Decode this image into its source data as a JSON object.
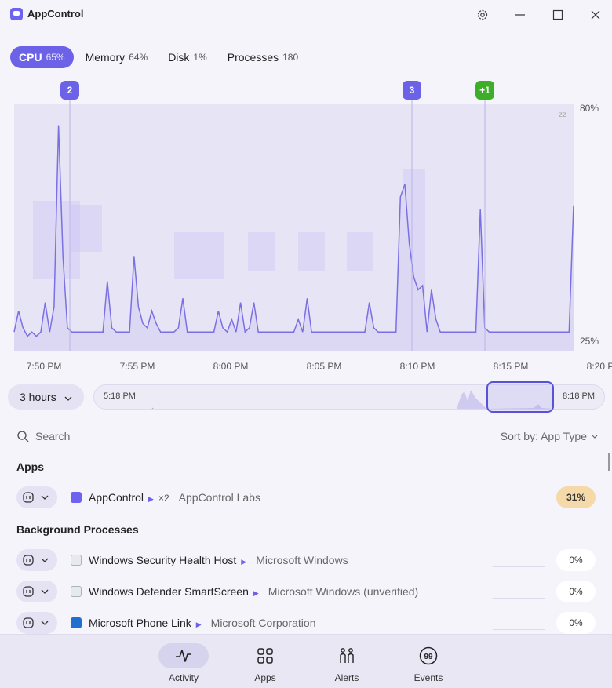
{
  "app": {
    "title": "AppControl"
  },
  "tabs": [
    {
      "label": "CPU",
      "value": "65%",
      "active": true
    },
    {
      "label": "Memory",
      "value": "64%"
    },
    {
      "label": "Disk",
      "value": "1%"
    },
    {
      "label": "Processes",
      "value": "180"
    }
  ],
  "chart": {
    "y_labels": {
      "top": "80%",
      "bottom": "25%"
    },
    "x_labels": [
      "7:50 PM",
      "7:55 PM",
      "8:00 PM",
      "8:05 PM",
      "8:10 PM",
      "8:15 PM",
      "8:20 PM"
    ],
    "markers": [
      {
        "label": "2",
        "color": "#6b62e8"
      },
      {
        "label": "3",
        "color": "#6b62e8"
      },
      {
        "label": "+1",
        "color": "#3cae28"
      }
    ],
    "sleep_icon": "zz"
  },
  "chart_data": {
    "type": "area",
    "ylim": [
      25,
      80
    ],
    "y_ticks": [
      "80%",
      "25%"
    ],
    "x_ticks": [
      "7:50 PM",
      "7:55 PM",
      "8:00 PM",
      "8:05 PM",
      "8:10 PM",
      "8:15 PM",
      "8:20 PM"
    ],
    "series": [
      {
        "values": [
          27,
          32,
          28,
          26,
          27,
          26,
          27,
          34,
          27,
          33,
          76,
          45,
          28,
          27,
          27,
          27,
          27,
          27,
          27,
          27,
          27,
          39,
          28,
          27,
          27,
          27,
          27,
          45,
          33,
          29,
          28,
          32,
          29,
          27,
          27,
          27,
          27,
          28,
          35,
          27,
          27,
          27,
          27,
          27,
          27,
          27,
          32,
          28,
          27,
          30,
          27,
          34,
          27,
          28,
          34,
          27,
          27,
          27,
          27,
          27,
          27,
          27,
          27,
          27,
          30,
          27,
          35,
          27,
          27,
          27,
          27,
          27,
          27,
          27,
          27,
          27,
          27,
          27,
          27,
          27,
          34,
          28,
          27,
          27,
          27,
          27,
          27,
          59,
          62,
          48,
          40,
          37,
          38,
          27,
          37,
          30,
          27,
          27,
          27,
          27,
          27,
          27,
          27,
          27,
          27,
          56,
          28,
          27,
          27,
          27,
          27,
          27,
          27,
          27,
          27,
          27,
          27,
          27,
          27,
          27,
          27,
          27,
          27,
          27,
          27,
          27,
          57
        ]
      }
    ]
  },
  "range": {
    "label": "3 hours",
    "start": "5:18 PM",
    "end": "8:18 PM"
  },
  "search": {
    "placeholder": "Search"
  },
  "sort": {
    "label": "Sort by: App Type"
  },
  "sections": {
    "apps": "Apps",
    "background": "Background Processes"
  },
  "apps": [
    {
      "name": "AppControl",
      "count": "×2",
      "publisher": "AppControl Labs",
      "percent": "31%",
      "icon_color": "#6e63ee"
    }
  ],
  "processes": [
    {
      "name": "Windows Security Health Host",
      "publisher": "Microsoft Windows",
      "percent": "0%",
      "icon_color": "#c9d2dc"
    },
    {
      "name": "Windows Defender SmartScreen",
      "publisher": "Microsoft Windows (unverified)",
      "percent": "0%",
      "icon_color": "#c9d2dc"
    },
    {
      "name": "Microsoft Phone Link",
      "publisher": "Microsoft Corporation",
      "percent": "0%",
      "icon_color": "#1e6fd0"
    }
  ],
  "nav": [
    {
      "label": "Activity",
      "icon": "activity-icon",
      "active": true
    },
    {
      "label": "Apps",
      "icon": "apps-grid-icon"
    },
    {
      "label": "Alerts",
      "icon": "alerts-icon"
    },
    {
      "label": "Events",
      "icon": "events-icon"
    }
  ]
}
